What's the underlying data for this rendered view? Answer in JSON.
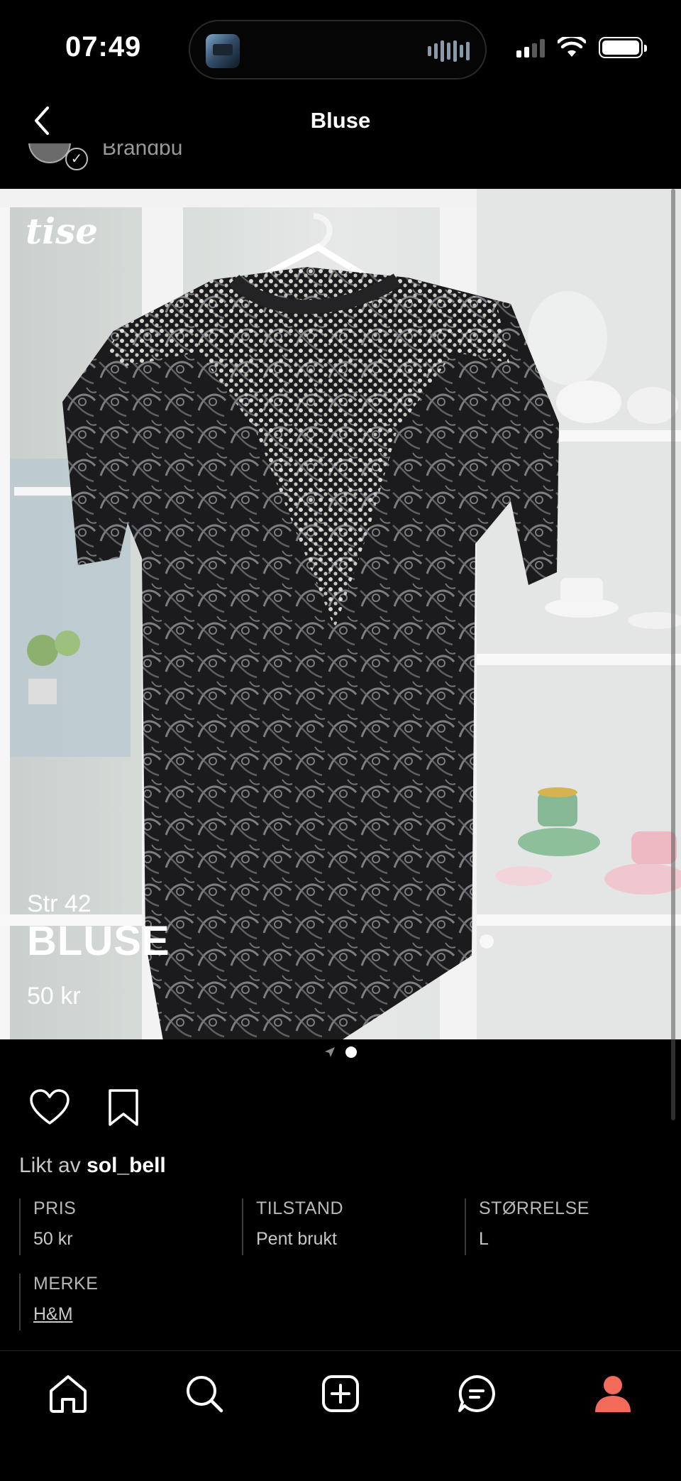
{
  "status_bar": {
    "time": "07:49"
  },
  "header": {
    "title": "Bluse",
    "back_icon": "chevron-left-icon"
  },
  "seller": {
    "name": "Brandbu"
  },
  "product": {
    "brand_logo": "tise",
    "size_label": "Str 42",
    "title": "BLUSE",
    "price": "50 kr",
    "carousel": {
      "count": 1,
      "active_index": 0
    }
  },
  "actions": {
    "like_icon": "heart-icon",
    "save_icon": "bookmark-icon"
  },
  "likes": {
    "prefix": "Likt av",
    "user": "sol_bell"
  },
  "attributes": [
    {
      "label": "PRIS",
      "value": "50 kr"
    },
    {
      "label": "TILSTAND",
      "value": "Pent brukt"
    },
    {
      "label": "STØRRELSE",
      "value": "L"
    },
    {
      "label": "MERKE",
      "value": "H&M"
    }
  ],
  "tabbar": {
    "items": [
      {
        "name": "home",
        "icon": "home-icon"
      },
      {
        "name": "search",
        "icon": "search-icon"
      },
      {
        "name": "sell",
        "icon": "plus-square-icon"
      },
      {
        "name": "messages",
        "icon": "chat-icon"
      },
      {
        "name": "profile",
        "icon": "user-icon",
        "active": true
      }
    ],
    "active_color": "#f26b5b"
  }
}
